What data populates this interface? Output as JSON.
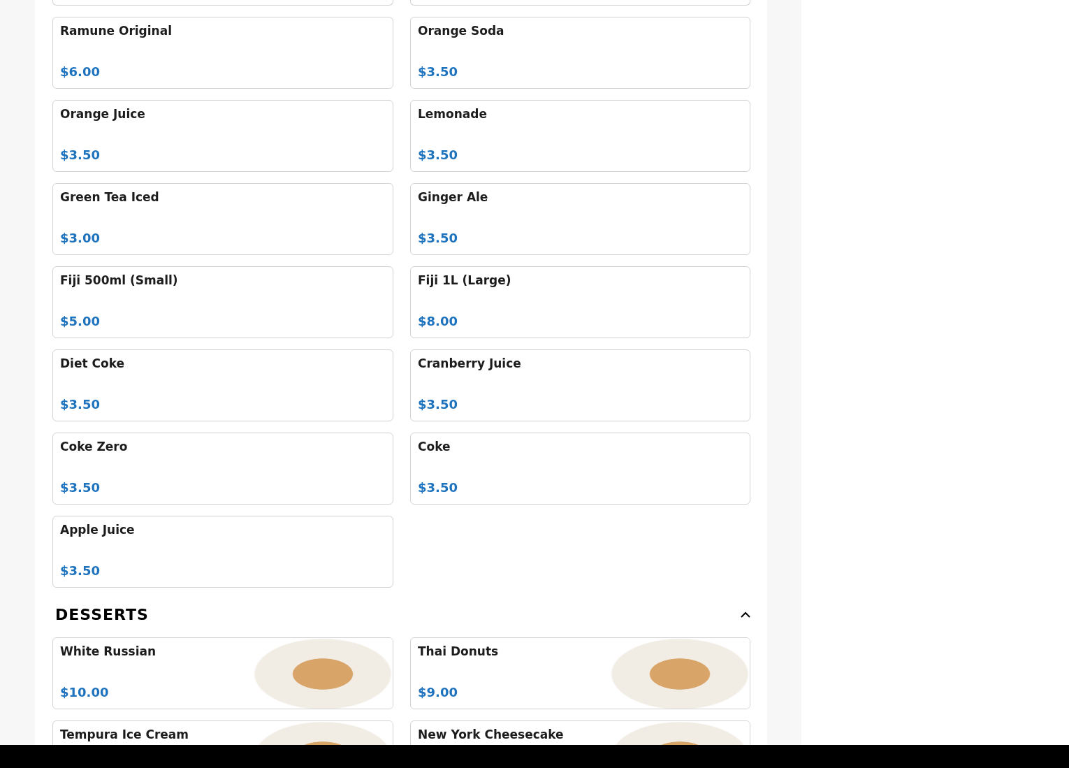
{
  "sections": [
    {
      "items": [
        {
          "name": "Ramune Original",
          "price": "$6.00",
          "photo": false
        },
        {
          "name": "Orange Soda",
          "price": "$3.50",
          "photo": false
        },
        {
          "name": "Orange Juice",
          "price": "$3.50",
          "photo": false
        },
        {
          "name": "Lemonade",
          "price": "$3.50",
          "photo": false
        },
        {
          "name": "Green Tea Iced",
          "price": "$3.00",
          "photo": false
        },
        {
          "name": "Ginger Ale",
          "price": "$3.50",
          "photo": false
        },
        {
          "name": "Fiji 500ml (Small)",
          "price": "$5.00",
          "photo": false
        },
        {
          "name": "Fiji 1L (Large)",
          "price": "$8.00",
          "photo": false
        },
        {
          "name": "Diet Coke",
          "price": "$3.50",
          "photo": false
        },
        {
          "name": "Cranberry Juice",
          "price": "$3.50",
          "photo": false
        },
        {
          "name": "Coke Zero",
          "price": "$3.50",
          "photo": false
        },
        {
          "name": "Coke",
          "price": "$3.50",
          "photo": false
        },
        {
          "name": "Apple Juice",
          "price": "$3.50",
          "photo": false
        }
      ]
    },
    {
      "title": "DESSERTS",
      "expanded": true,
      "items": [
        {
          "name": "White Russian",
          "price": "$10.00",
          "photo": true
        },
        {
          "name": "Thai Donuts",
          "price": "$9.00",
          "photo": true
        },
        {
          "name": "Tempura Ice Cream",
          "photo": true
        },
        {
          "name": "New York Cheesecake",
          "photo": true
        }
      ]
    }
  ]
}
